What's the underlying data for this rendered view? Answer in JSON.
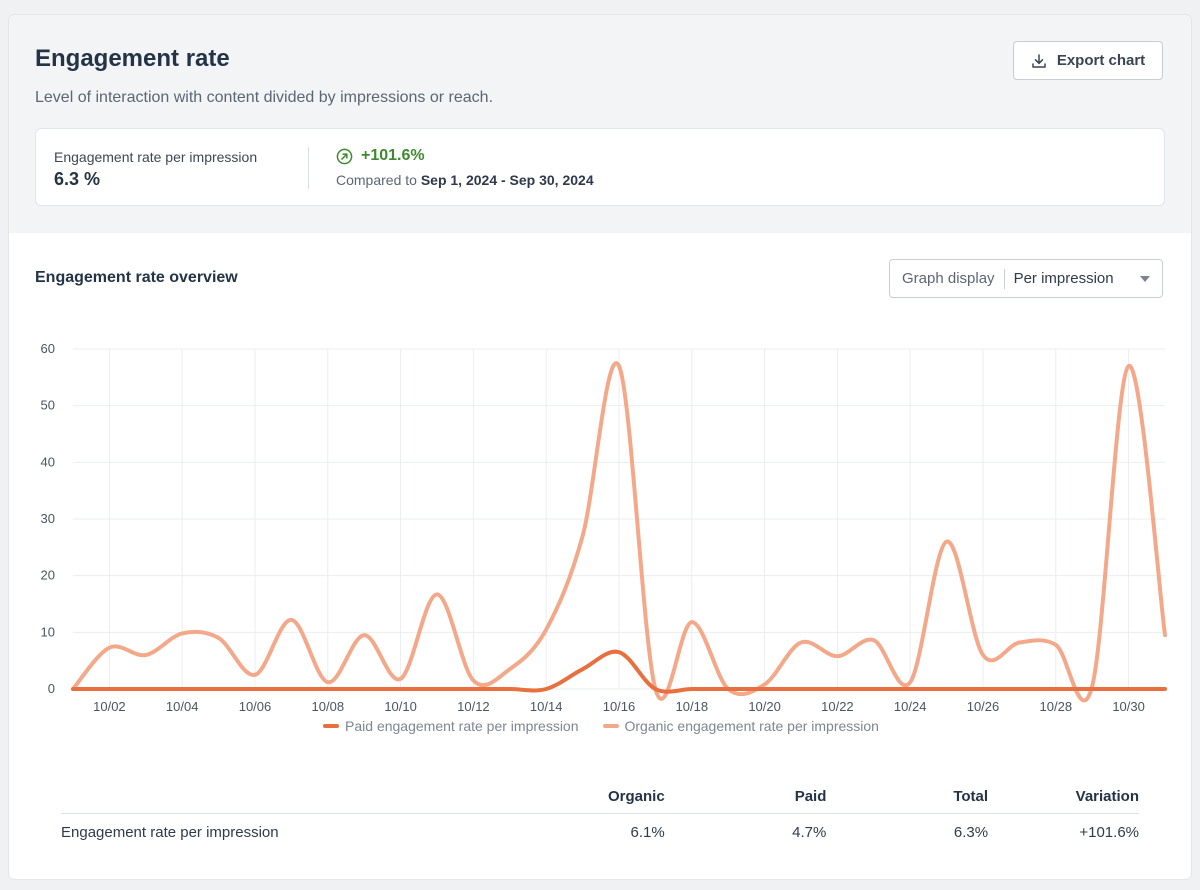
{
  "header": {
    "title": "Engagement rate",
    "subtitle": "Level of interaction with content divided by impressions or reach.",
    "export_label": "Export chart"
  },
  "summary": {
    "label": "Engagement rate per impression",
    "value": "6.3 %",
    "delta": "+101.6%",
    "compare_prefix": "Compared to",
    "compare_range": "Sep 1, 2024 - Sep 30, 2024"
  },
  "overview": {
    "title": "Engagement rate overview",
    "graph_display_label": "Graph display",
    "graph_display_value": "Per impression"
  },
  "colors": {
    "paid": "#e8703f",
    "organic": "#f4a88a",
    "positive": "#3f8a2e"
  },
  "chart_data": {
    "type": "line",
    "x": [
      "10/01",
      "10/02",
      "10/03",
      "10/04",
      "10/05",
      "10/06",
      "10/07",
      "10/08",
      "10/09",
      "10/10",
      "10/11",
      "10/12",
      "10/13",
      "10/14",
      "10/15",
      "10/16",
      "10/17",
      "10/18",
      "10/19",
      "10/20",
      "10/21",
      "10/22",
      "10/23",
      "10/24",
      "10/25",
      "10/26",
      "10/27",
      "10/28",
      "10/29",
      "10/30",
      "10/31"
    ],
    "x_tick_labels": [
      "10/02",
      "10/04",
      "10/06",
      "10/08",
      "10/10",
      "10/12",
      "10/14",
      "10/16",
      "10/18",
      "10/20",
      "10/22",
      "10/24",
      "10/26",
      "10/28",
      "10/30"
    ],
    "ylim": [
      0,
      60
    ],
    "yticks": [
      0,
      10,
      20,
      30,
      40,
      50,
      60
    ],
    "grid": true,
    "legend_position": "bottom",
    "series": [
      {
        "name": "Paid engagement rate per impression",
        "values": [
          0,
          0,
          0,
          0,
          0,
          0,
          0,
          0,
          0,
          0,
          0,
          0,
          0,
          0,
          3.5,
          6.5,
          0,
          0,
          0,
          0,
          0,
          0,
          0,
          0,
          0,
          0,
          0,
          0,
          0,
          0,
          0
        ]
      },
      {
        "name": "Organic engagement rate per impression",
        "values": [
          0,
          7.3,
          6,
          9.8,
          9,
          2.5,
          12.2,
          1.2,
          9.5,
          1.8,
          16.7,
          1.5,
          3.5,
          10.5,
          27,
          57,
          0,
          11.8,
          0,
          0.8,
          8.2,
          5.8,
          8.6,
          1.2,
          26,
          6,
          8.2,
          7.8,
          0.5,
          57,
          9.5
        ]
      }
    ]
  },
  "table": {
    "headers": [
      "",
      "Organic",
      "Paid",
      "Total",
      "Variation"
    ],
    "rows": [
      [
        "Engagement rate per impression",
        "6.1%",
        "4.7%",
        "6.3%",
        "+101.6%"
      ]
    ]
  }
}
